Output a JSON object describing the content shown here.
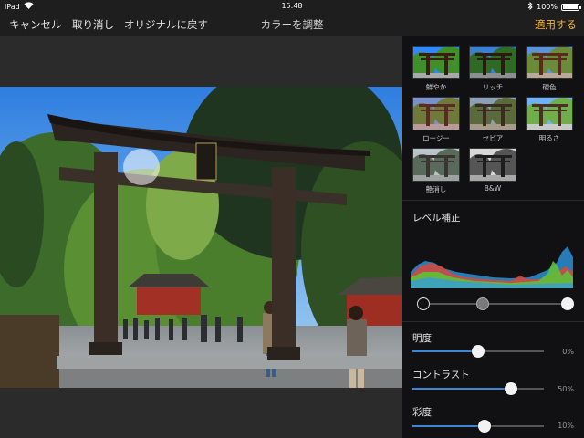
{
  "status_bar": {
    "device": "iPad",
    "time": "15:48",
    "battery_percent": "100%",
    "battery_level": 1.0
  },
  "nav": {
    "cancel_label": "キャンセル",
    "undo_label": "取り消し",
    "revert_label": "オリジナルに戻す",
    "title": "カラーを調整",
    "apply_label": "適用する"
  },
  "presets": [
    {
      "label": "鮮やか",
      "style": "vivid"
    },
    {
      "label": "リッチ",
      "style": "rich"
    },
    {
      "label": "硬色",
      "style": "hard"
    },
    {
      "label": "ロージー",
      "style": "rosy"
    },
    {
      "label": "セピア",
      "style": "sepia"
    },
    {
      "label": "明るさ",
      "style": "bright"
    },
    {
      "label": "艶消し",
      "style": "matte"
    },
    {
      "label": "B&W",
      "style": "bw"
    }
  ],
  "levels": {
    "label": "レベル補正",
    "black_point": 0.0,
    "mid_point": 0.41,
    "white_point": 1.0
  },
  "sliders": [
    {
      "label": "明度",
      "value": "0%",
      "position": 0.5
    },
    {
      "label": "コントラスト",
      "value": "50%",
      "position": 0.75
    },
    {
      "label": "彩度",
      "value": "10%",
      "position": 0.55
    }
  ],
  "colors": {
    "accent": "#f4b43c",
    "slider_fill": "#3d86d6",
    "slider_track": "#555555"
  }
}
